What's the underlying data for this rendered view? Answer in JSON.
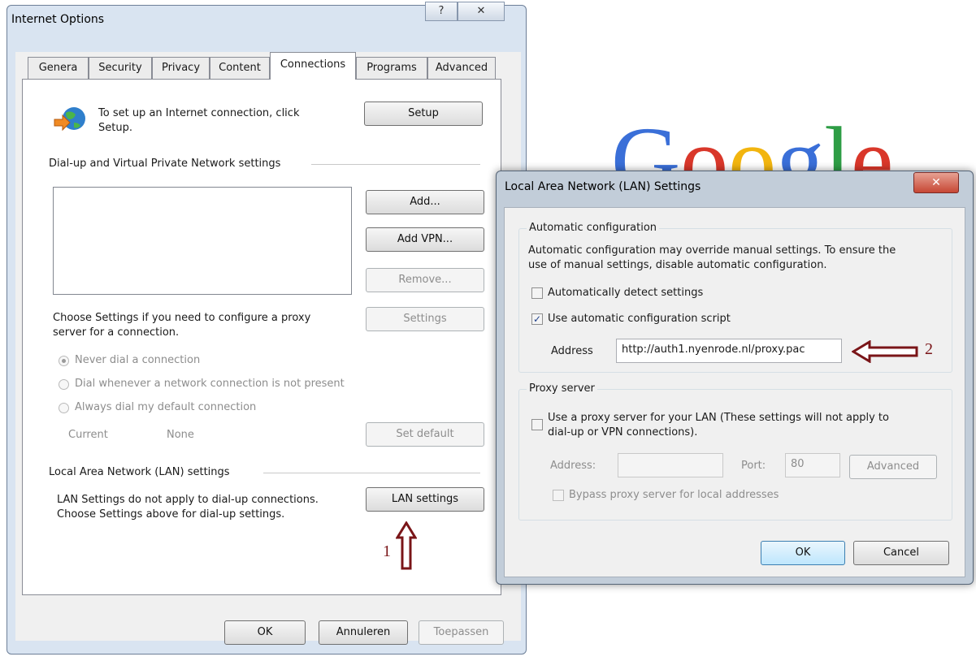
{
  "internet_options": {
    "title": "Internet Options",
    "caption_help": "?",
    "caption_close": "✕",
    "tabs": [
      "Genera",
      "Security",
      "Privacy",
      "Content",
      "Connections",
      "Programs",
      "Advanced"
    ],
    "active_tab": "Connections",
    "setup_text_1": "To set up an Internet connection, click",
    "setup_text_2": "Setup.",
    "setup_button": "Setup",
    "vpn_heading": "Dial-up and Virtual Private Network settings",
    "add_button": "Add...",
    "add_vpn_button": "Add VPN...",
    "remove_button": "Remove...",
    "proxy_text_1": "Choose Settings if you need to configure a proxy",
    "proxy_text_2": "server for a connection.",
    "settings_button": "Settings",
    "radio_never": "Never dial a connection",
    "radio_whenever": "Dial whenever a network connection is not present",
    "radio_always": "Always dial my default connection",
    "current_label": "Current",
    "current_value": "None",
    "set_default_button": "Set default",
    "lan_heading": "Local Area Network (LAN) settings",
    "lan_text_1": "LAN Settings do not apply to dial-up connections.",
    "lan_text_2": "Choose Settings above for dial-up settings.",
    "lan_settings_button": "LAN settings",
    "ok_button": "OK",
    "cancel_button": "Annuleren",
    "apply_button": "Toepassen"
  },
  "annotations": {
    "marker_1": "1",
    "marker_2": "2",
    "color": "#7a1518"
  },
  "background_logo": {
    "text": "Google",
    "colors": [
      "#3a6fd8",
      "#d9372a",
      "#f2b50f",
      "#3a6fd8",
      "#2e9d45",
      "#d9372a"
    ]
  },
  "lan_dialog": {
    "title": "Local Area Network (LAN) Settings",
    "close": "✕",
    "auto_group": "Automatic configuration",
    "auto_desc_1": "Automatic configuration may override manual settings.  To ensure the",
    "auto_desc_2": "use of manual settings, disable automatic configuration.",
    "auto_detect_label": "Automatically detect settings",
    "auto_detect_checked": false,
    "use_script_label": "Use automatic configuration script",
    "use_script_checked": true,
    "address_label": "Address",
    "address_value": "http://auth1.nyenrode.nl/proxy.pac",
    "proxy_group": "Proxy server",
    "use_proxy_label_1": "Use a proxy server for your LAN (These settings will not apply to",
    "use_proxy_label_2": "dial-up or VPN connections).",
    "use_proxy_checked": false,
    "proxy_address_label": "Address:",
    "proxy_address_value": "",
    "port_label": "Port:",
    "port_value": "80",
    "advanced_button": "Advanced",
    "bypass_label": "Bypass proxy server for local addresses",
    "ok_button": "OK",
    "cancel_button": "Cancel"
  }
}
